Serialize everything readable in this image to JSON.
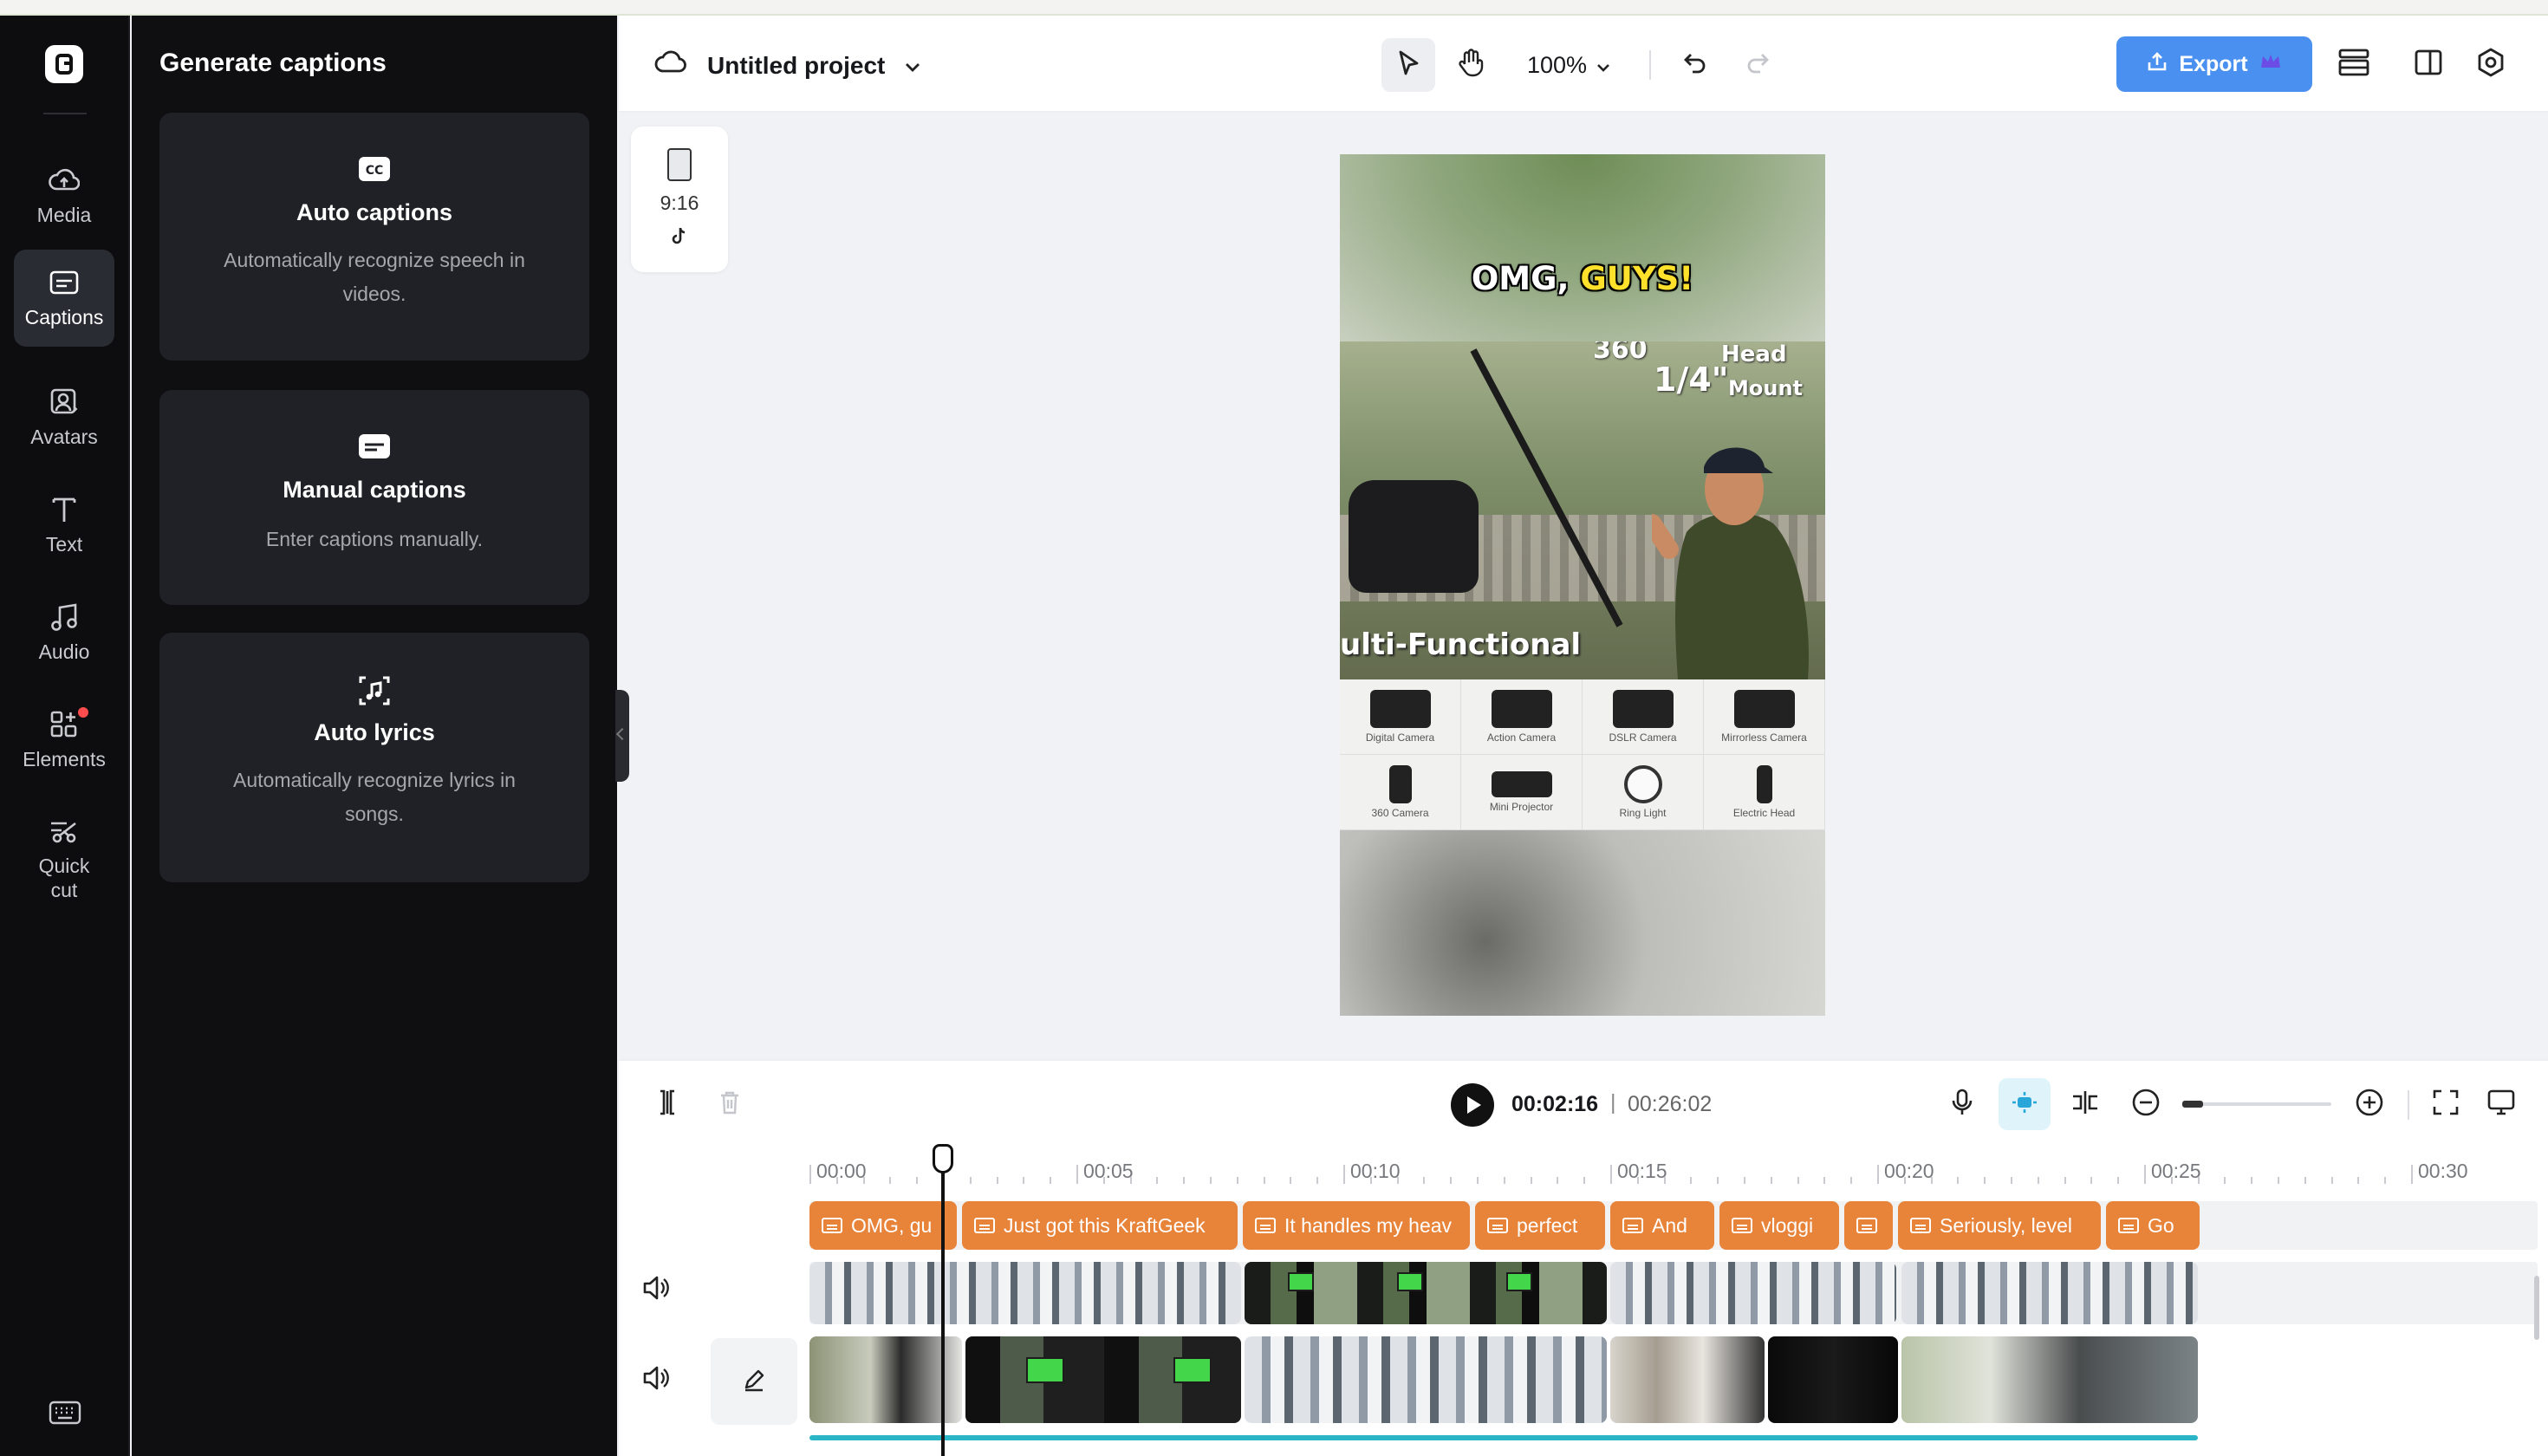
{
  "sidebar": {
    "items": [
      {
        "label": "Media",
        "icon": "media-cloud-icon"
      },
      {
        "label": "Captions",
        "icon": "captions-icon",
        "active": true
      },
      {
        "label": "Avatars",
        "icon": "avatar-icon"
      },
      {
        "label": "Text",
        "icon": "text-icon"
      },
      {
        "label": "Audio",
        "icon": "music-note-icon"
      },
      {
        "label": "Elements",
        "icon": "elements-icon",
        "badge": true
      },
      {
        "label": "Quick\ncut",
        "icon": "scissors-icon"
      }
    ]
  },
  "panel": {
    "title": "Generate captions",
    "cards": [
      {
        "title": "Auto captions",
        "desc": "Automatically recognize speech in videos.",
        "icon": "cc-icon"
      },
      {
        "title": "Manual captions",
        "desc": "Enter captions manually.",
        "icon": "subtitle-icon"
      },
      {
        "title": "Auto lyrics",
        "desc": "Automatically recognize lyrics in songs.",
        "icon": "lyrics-icon"
      }
    ]
  },
  "topbar": {
    "project_name": "Untitled project",
    "zoom": "100%",
    "export_label": "Export"
  },
  "canvas": {
    "aspect_ratio": "9:16",
    "video": {
      "caption_white": "OMG,",
      "caption_yellow": "GUYS!",
      "overlay_360": "360",
      "overlay_quarter": "1/4\"",
      "overlay_head": "Head",
      "overlay_mount": "Mount",
      "overlay_multi": "ulti-Functional",
      "grid_labels": [
        "Digital Camera",
        "Action Camera",
        "DSLR Camera",
        "Mirrorless Camera",
        "360 Camera",
        "Mini Projector",
        "Ring Light",
        "Electric Head"
      ]
    }
  },
  "playback": {
    "current_time": "00:02:16",
    "separator": "|",
    "total_time": "00:26:02"
  },
  "timeline": {
    "ruler": [
      "00:00",
      "00:05",
      "00:10",
      "00:15",
      "00:20",
      "00:25",
      "00:30"
    ],
    "caption_clips": [
      "OMG, gu",
      "Just got this KraftGeek",
      "It handles my heav",
      "perfect",
      "And",
      "vloggi",
      "",
      "Seriously, level",
      "Go"
    ]
  },
  "colors": {
    "accent": "#4a90f0",
    "caption_clip": "#e8833a",
    "caption_highlight": "#ffe12b",
    "badge": "#ff4d4d"
  }
}
